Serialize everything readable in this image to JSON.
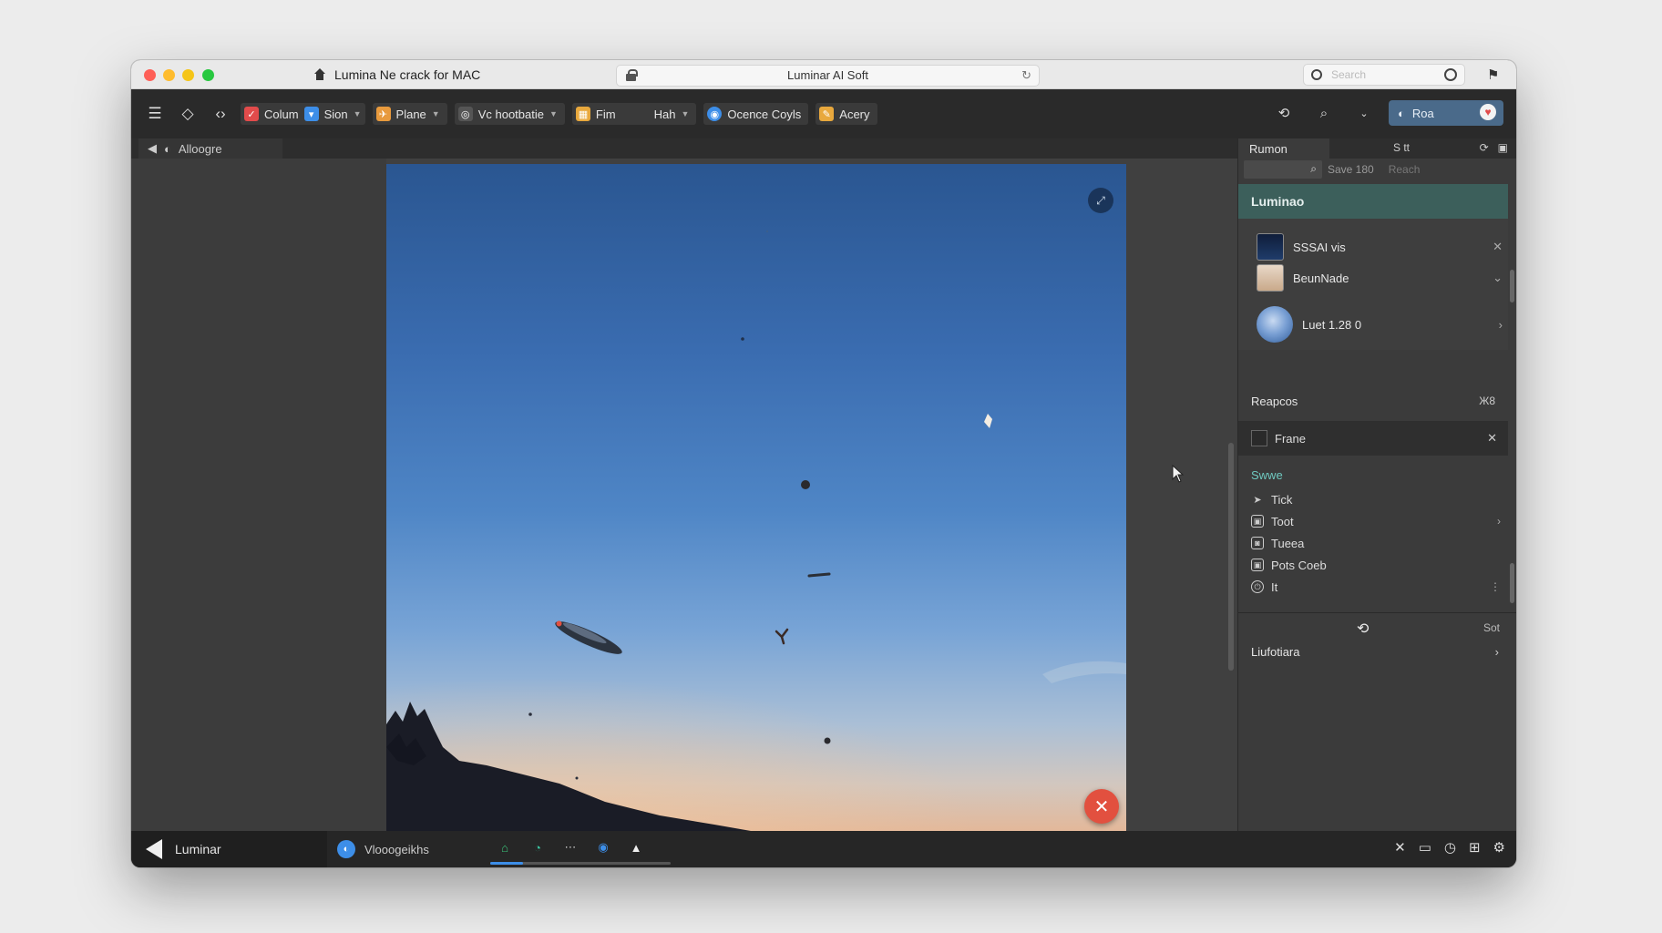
{
  "titlebar": {
    "tab_title": "Lumina Ne crack for MAC",
    "url": "Luminar AI Soft",
    "search_placeholder": "Search"
  },
  "toolbar": {
    "chips": [
      {
        "label": "Colum",
        "icon": "check-icon",
        "color": "#e24b4b"
      },
      {
        "label": "Sion",
        "icon": "stack-icon",
        "color": "#3d8ee8"
      },
      {
        "label": "Plane",
        "icon": "plane-icon",
        "color": "#e89a3d"
      },
      {
        "label": "Vc hootbatie",
        "icon": "eye-icon",
        "color": "#555555"
      },
      {
        "label": "Fim",
        "icon": "film-icon",
        "color": "#e8a83d"
      },
      {
        "label": "Hah",
        "icon": "none",
        "color": "#3a3a3a"
      },
      {
        "label": "Ocence Coyls",
        "icon": "globe-icon",
        "color": "#3d8ee8"
      },
      {
        "label": "Acery",
        "icon": "brush-icon",
        "color": "#e8a83d"
      }
    ],
    "user_label": "Roa"
  },
  "subbar": {
    "crumb": "Alloogre"
  },
  "right_panel": {
    "tab_active": "Rumon",
    "tab_second": "S tt",
    "search_hint": "Save 180",
    "search_hint2": "Reach",
    "header": "Luminao",
    "layers": [
      {
        "name": "SSSAI vis"
      },
      {
        "name": "BeunNade"
      },
      {
        "name": "Luet 1.28 0"
      }
    ],
    "section_presets": "Reapcos",
    "section_presets_key": "Ж8",
    "frame_label": "Frane",
    "list_title": "Swwe",
    "list_items": [
      {
        "label": "Tick",
        "icon": "arrow-icon"
      },
      {
        "label": "Toot",
        "icon": "image-icon"
      },
      {
        "label": "Tueea",
        "icon": "shield-icon"
      },
      {
        "label": "Pots Coeb",
        "icon": "image-icon"
      },
      {
        "label": "It",
        "icon": "power-icon"
      }
    ],
    "set_label": "Sot",
    "bottom_label": "Liufotiara"
  },
  "statusbar": {
    "app_title": "Luminar",
    "item_label": "Vlooogeikhs",
    "progress": 0.18
  },
  "colors": {
    "accent": "#3d8ee8",
    "header_teal": "#3c5f5b",
    "close_red": "#e2503f"
  }
}
